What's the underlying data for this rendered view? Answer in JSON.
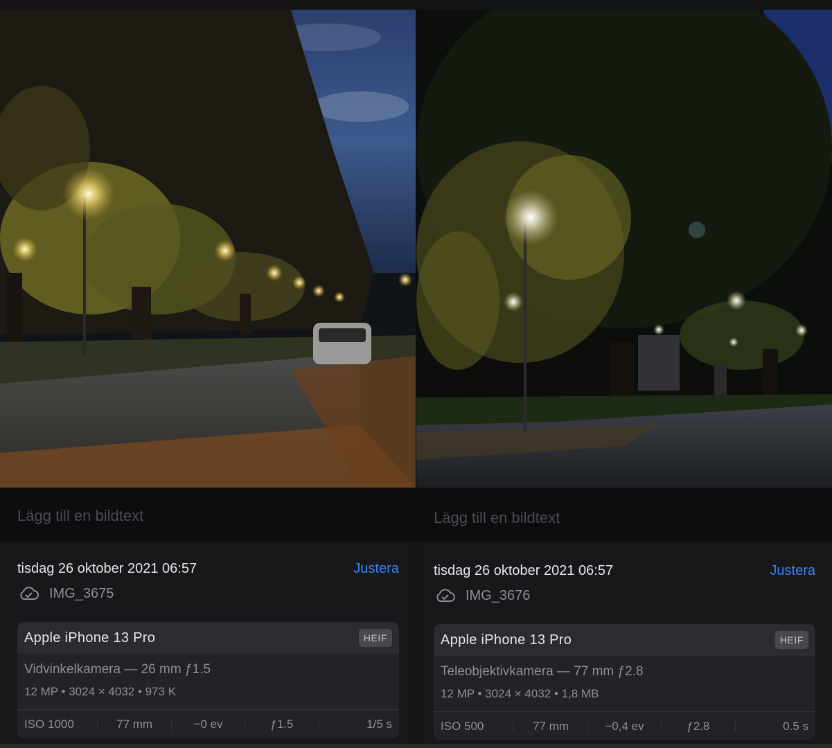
{
  "panels": [
    {
      "caption_placeholder": "Lägg till en bildtext",
      "datetime": "tisdag 26 oktober 2021 06:57",
      "adjust_label": "Justera",
      "filename": "IMG_3675",
      "cloud_icon": "cloud-check-icon",
      "device": "Apple iPhone 13 Pro",
      "format_badge": "HEIF",
      "lens": "Vidvinkelkamera — 26 mm ƒ1.5",
      "specs": "12 MP  •  3024 × 4032  •  973 K",
      "exif": {
        "iso": "ISO 1000",
        "focal": "77 mm",
        "ev": "−0 ev",
        "aperture": "ƒ1.5",
        "shutter": "1/5 s"
      }
    },
    {
      "caption_placeholder": "Lägg till en bildtext",
      "datetime": "tisdag 26 oktober 2021 06:57",
      "adjust_label": "Justera",
      "filename": "IMG_3676",
      "cloud_icon": "cloud-check-icon",
      "device": "Apple iPhone 13 Pro",
      "format_badge": "HEIF",
      "lens": "Teleobjektivkamera — 77 mm ƒ2.8",
      "specs": "12 MP  •  3024 × 4032  •  1,8 MB",
      "exif": {
        "iso": "ISO 500",
        "focal": "77 mm",
        "ev": "−0,4 ev",
        "aperture": "ƒ2.8",
        "shutter": "0.5 s"
      }
    }
  ],
  "colors": {
    "accent": "#3b82f6",
    "background": "#141416",
    "card": "#232327",
    "text_secondary": "#8e8e93"
  }
}
